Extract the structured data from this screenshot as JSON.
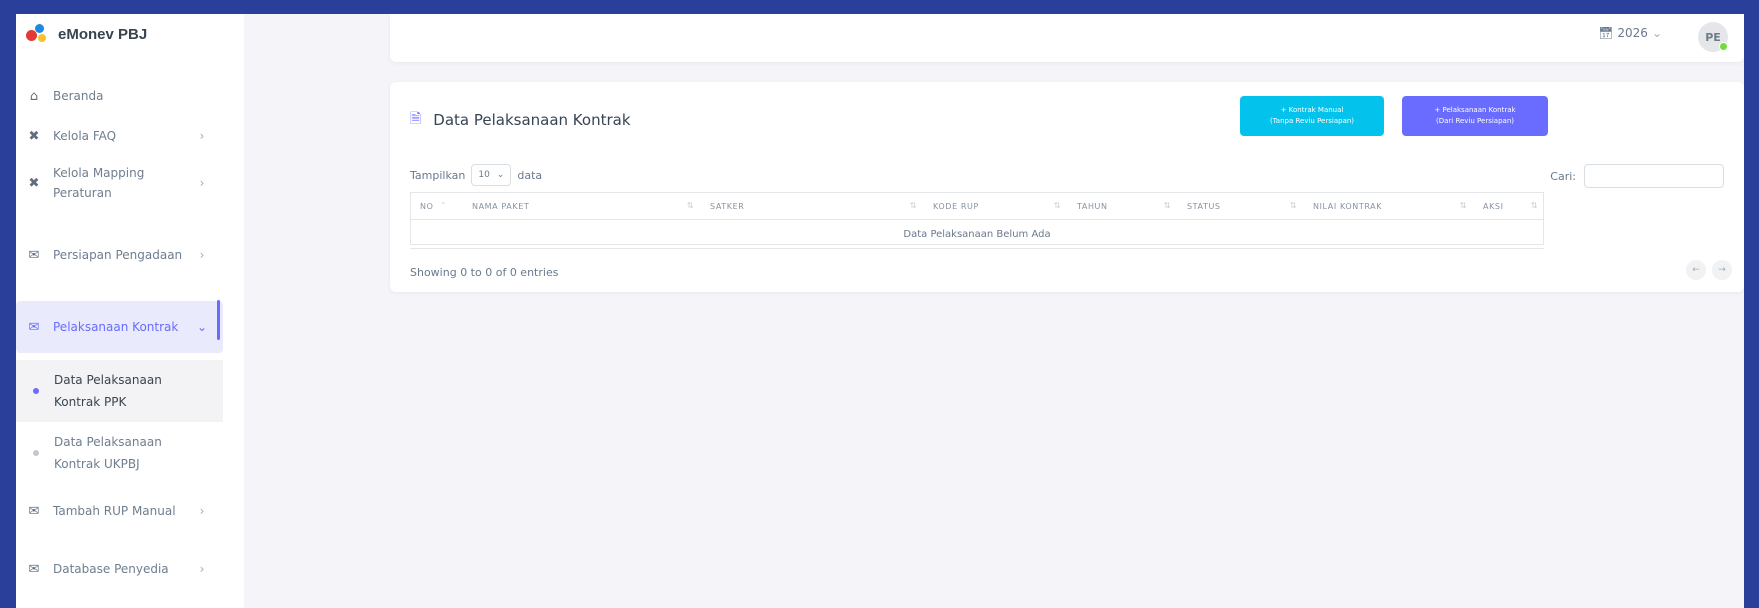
{
  "brand": {
    "name": "eMonev PBJ"
  },
  "sidebar": {
    "items": [
      {
        "label": "Beranda",
        "icon": "home-icon"
      },
      {
        "label": "Kelola FAQ",
        "icon": "tool-icon"
      },
      {
        "label": "Kelola Mapping Peraturan",
        "icon": "tool-icon"
      },
      {
        "label": "Persiapan Pengadaan",
        "icon": "envelope-icon"
      },
      {
        "label": "Pelaksanaan Kontrak",
        "icon": "envelope-icon"
      },
      {
        "label": "Tambah RUP Manual",
        "icon": "envelope-icon"
      },
      {
        "label": "Database Penyedia",
        "icon": "envelope-icon"
      }
    ],
    "subitems": [
      {
        "label": "Data Pelaksanaan Kontrak PPK"
      },
      {
        "label": "Data Pelaksanaan Kontrak UKPBJ"
      }
    ]
  },
  "navbar": {
    "year": "2026",
    "avatar_initials": "PE"
  },
  "card": {
    "title": "Data Pelaksanaan Kontrak",
    "btn_manual_line1": "+ Kontrak Manual",
    "btn_manual_line2": "(Tanpa Reviu Persiapan)",
    "btn_pelaksanaan_line1": "+ Pelaksanaan Kontrak",
    "btn_pelaksanaan_line2": "(Dari Reviu Persiapan)",
    "show_label": "Tampilkan",
    "show_value": "10",
    "data_label": "data",
    "search_label": "Cari:"
  },
  "table": {
    "headers": [
      "NO",
      "NAMA PAKET",
      "SATKER",
      "KODE RUP",
      "TAHUN",
      "STATUS",
      "NILAI KONTRAK",
      "AKSI"
    ],
    "empty_message": "Data Pelaksanaan Belum Ada",
    "info": "Showing 0 to 0 of 0 entries"
  },
  "colors": {
    "primary": "#696cff",
    "info": "#03c3ec",
    "frame": "#2a3f9a"
  }
}
